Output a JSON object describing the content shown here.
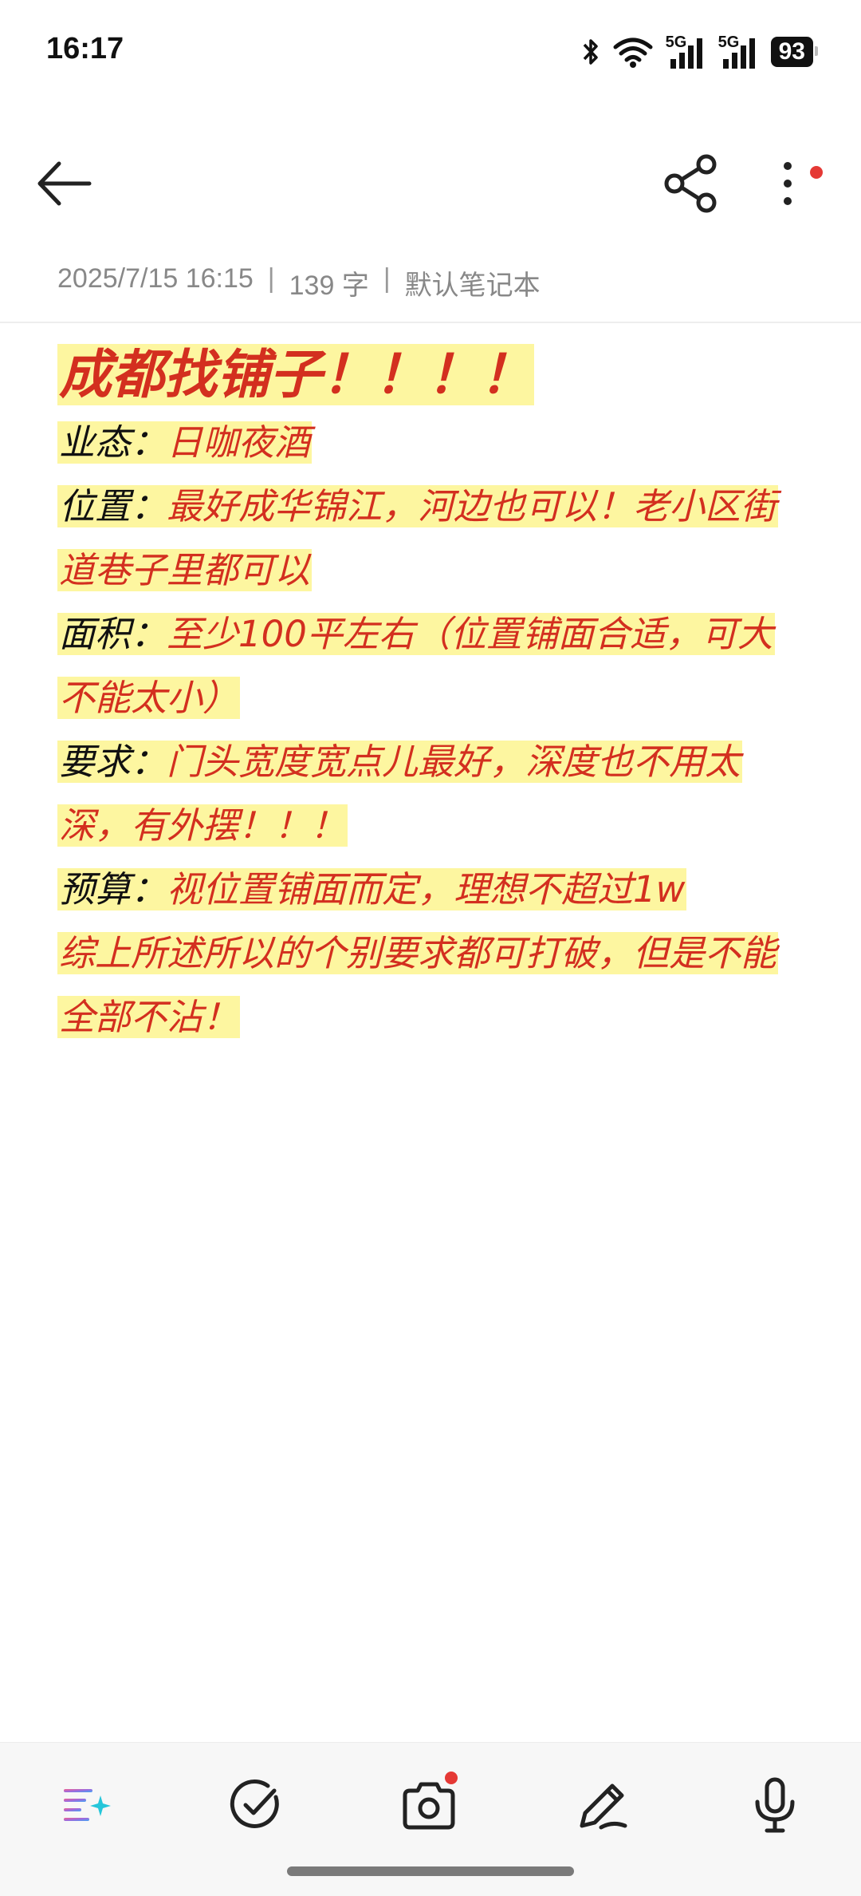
{
  "status_bar": {
    "time": "16:17",
    "battery": "93",
    "network1": "5G",
    "network2": "5G",
    "icons": [
      "bluetooth-icon",
      "wifi-icon",
      "signal-5g-icon",
      "signal-5g-icon",
      "battery-icon"
    ]
  },
  "nav": {
    "back_icon": "arrow-left-icon",
    "share_icon": "share-icon",
    "more_icon": "more-vertical-icon",
    "badge_color": "#e53935"
  },
  "meta": {
    "datetime": "2025/7/15 16:15",
    "separator": "|",
    "word_count": "139 字",
    "notebook": "默认笔记本"
  },
  "note": {
    "title": "成都找铺子！！！！",
    "lines": [
      {
        "label": "业态：",
        "value": "日咖夜酒"
      },
      {
        "label": "位置：",
        "value": "最好成华锦江，河边也可以！老小区街道巷子里都可以"
      },
      {
        "label": "面积：",
        "value": "至少100平左右（位置铺面合适，可大不能太小）"
      },
      {
        "label": "要求：",
        "value": "门头宽度宽点儿最好，深度也不用太深，有外摆！！！"
      },
      {
        "label": "预算：",
        "value": "视位置铺面而定，理想不超过1w"
      },
      {
        "label": "",
        "value": "综上所述所以的个别要求都可打破，但是不能全部不沾！"
      }
    ],
    "highlight_color": "#fdf6a0",
    "accent_color": "#d32f1f"
  },
  "toolbar": {
    "items": [
      "ai-format-icon",
      "checklist-icon",
      "camera-icon",
      "pen-icon",
      "microphone-icon"
    ]
  }
}
